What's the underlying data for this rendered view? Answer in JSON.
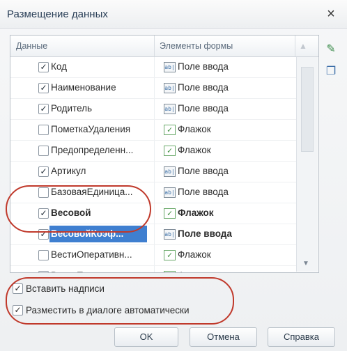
{
  "window": {
    "title": "Размещение данных",
    "close_symbol": "×"
  },
  "table": {
    "col_data": "Данные",
    "col_elements": "Элементы формы",
    "rows": [
      {
        "name": "Код",
        "checked": true,
        "element": "Поле ввода",
        "etype": "input",
        "bold": false,
        "selected": false
      },
      {
        "name": "Наименование",
        "checked": true,
        "element": "Поле ввода",
        "etype": "input",
        "bold": false,
        "selected": false
      },
      {
        "name": "Родитель",
        "checked": true,
        "element": "Поле ввода",
        "etype": "input",
        "bold": false,
        "selected": false
      },
      {
        "name": "ПометкаУдаления",
        "checked": false,
        "element": "Флажок",
        "etype": "flag",
        "bold": false,
        "selected": false
      },
      {
        "name": "Предопределенн...",
        "checked": false,
        "element": "Флажок",
        "etype": "flag",
        "bold": false,
        "selected": false
      },
      {
        "name": "Артикул",
        "checked": true,
        "element": "Поле ввода",
        "etype": "input",
        "bold": false,
        "selected": false
      },
      {
        "name": "БазоваяЕдиница...",
        "checked": false,
        "element": "Поле ввода",
        "etype": "input",
        "bold": false,
        "selected": false
      },
      {
        "name": "Весовой",
        "checked": true,
        "element": "Флажок",
        "etype": "flag",
        "bold": true,
        "selected": false
      },
      {
        "name": "ВесовойКоэф...",
        "checked": true,
        "element": "Поле ввода",
        "etype": "input",
        "bold": true,
        "selected": true
      },
      {
        "name": "ВестиОперативн...",
        "checked": false,
        "element": "Флажок",
        "etype": "flag",
        "bold": false,
        "selected": false
      },
      {
        "name": "ВестиПартионны...",
        "checked": false,
        "element": "Флажок",
        "etype": "flag",
        "bold": false,
        "selected": false
      }
    ]
  },
  "options": [
    {
      "label": "Вставить надписи",
      "checked": true
    },
    {
      "label": "Разместить в диалоге автоматически",
      "checked": true
    }
  ],
  "buttons": {
    "ok": "OK",
    "cancel": "Отмена",
    "help": "Справка"
  },
  "icons": {
    "side_1": "add-field-icon",
    "side_2": "copy-icon"
  },
  "colors": {
    "selection": "#3f7fd0",
    "annotation": "#c0392b"
  }
}
